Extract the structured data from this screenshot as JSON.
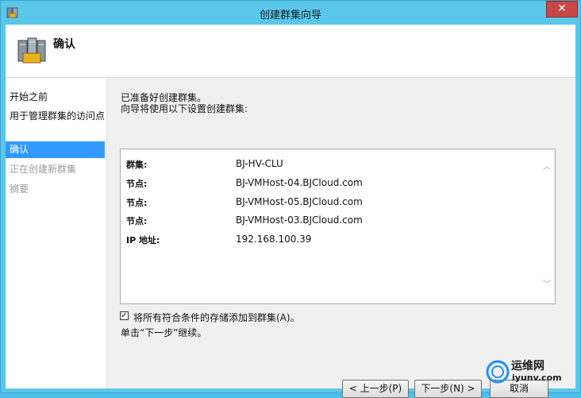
{
  "window": {
    "title": "创建群集向导",
    "close_label": "✕"
  },
  "header": {
    "title": "确认"
  },
  "steps": [
    {
      "label": "开始之前",
      "state": "normal"
    },
    {
      "label": "用于管理群集的访问点",
      "state": "normal"
    },
    {
      "label": "确认",
      "state": "active"
    },
    {
      "label": "正在创建新群集",
      "state": "disabled"
    },
    {
      "label": "摘要",
      "state": "disabled"
    }
  ],
  "main": {
    "line1": "已准备好创建群集。",
    "line2": "向导将使用以下设置创建群集:",
    "details": [
      {
        "key": "群集:",
        "value": "BJ-HV-CLU"
      },
      {
        "key": "节点:",
        "value": "BJ-VMHost-04.BJCloud.com"
      },
      {
        "key": "节点:",
        "value": "BJ-VMHost-05.BJCloud.com"
      },
      {
        "key": "节点:",
        "value": "BJ-VMHost-03.BJCloud.com"
      },
      {
        "key": "IP 地址:",
        "value": "192.168.100.39"
      }
    ],
    "checkbox": {
      "label": "将所有符合条件的存储添加到群集(A)。",
      "checked": true,
      "mark": "✓"
    },
    "hint": "单击“下一步”继续。"
  },
  "buttons": {
    "prev": "< 上一步(P)",
    "next": "下一步(N) >",
    "cancel": "取消"
  },
  "watermark": {
    "text": "运维网",
    "url": "iyunv.com"
  },
  "colors": {
    "titlebar": "#5ac7ea",
    "selection": "#3399ff",
    "close": "#c84646"
  }
}
